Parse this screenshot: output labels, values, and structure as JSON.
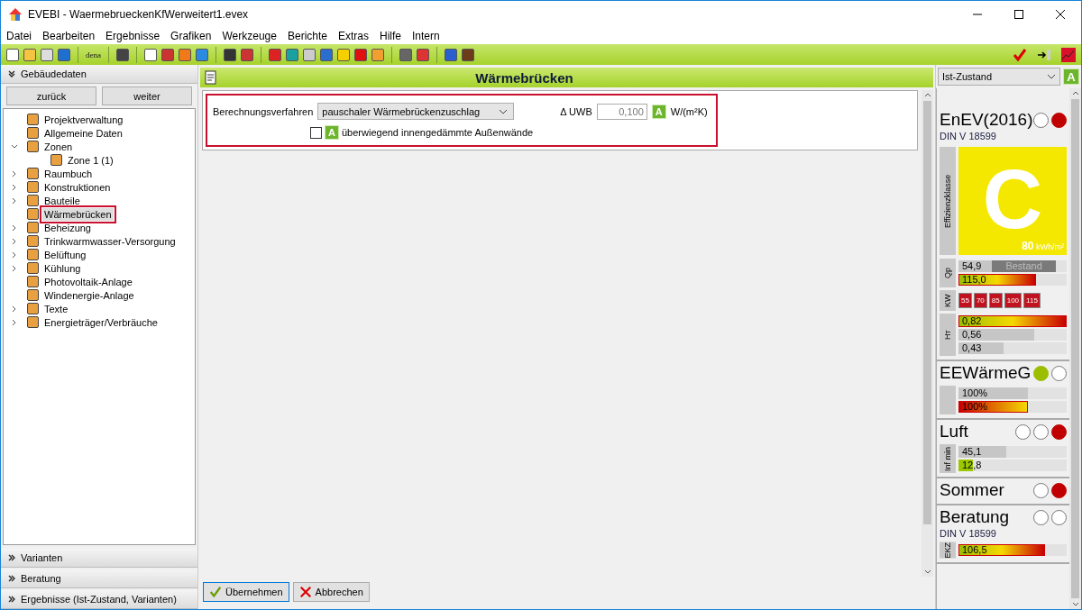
{
  "window": {
    "title": "EVEBI - WaermebrueckenKfWerweitert1.evex"
  },
  "menu": [
    "Datei",
    "Bearbeiten",
    "Ergebnisse",
    "Grafiken",
    "Werkzeuge",
    "Berichte",
    "Extras",
    "Hilfe",
    "Intern"
  ],
  "toolbar": {
    "text_button": "dena"
  },
  "sidebar": {
    "header": "Gebäudedaten",
    "nav_buttons": [
      "zurück",
      "weiter"
    ],
    "tree": [
      {
        "label": "Projektverwaltung",
        "selected": false
      },
      {
        "label": "Allgemeine Daten",
        "selected": false
      },
      {
        "label": "Zonen",
        "selected": false,
        "expanded": true,
        "children": [
          {
            "label": "Zone 1 (1)",
            "selected": false
          }
        ]
      },
      {
        "label": "Raumbuch",
        "selected": false,
        "expanded": false
      },
      {
        "label": "Konstruktionen",
        "selected": false,
        "expanded": false
      },
      {
        "label": "Bauteile",
        "selected": false,
        "expanded": false
      },
      {
        "label": "Wärmebrücken",
        "selected": true
      },
      {
        "label": "Beheizung",
        "selected": false,
        "expanded": false
      },
      {
        "label": "Trinkwarmwasser-Versorgung",
        "selected": false,
        "expanded": false
      },
      {
        "label": "Belüftung",
        "selected": false,
        "expanded": false
      },
      {
        "label": "Kühlung",
        "selected": false,
        "expanded": false
      },
      {
        "label": "Photovoltaik-Anlage",
        "selected": false
      },
      {
        "label": "Windenergie-Anlage",
        "selected": false
      },
      {
        "label": "Texte",
        "selected": false,
        "expanded": false
      },
      {
        "label": "Energieträger/Verbräuche",
        "selected": false,
        "expanded": false
      }
    ],
    "sections": [
      "Varianten",
      "Beratung",
      "Ergebnisse (Ist-Zustand, Varianten)"
    ]
  },
  "main": {
    "title": "Wärmebrücken",
    "form": {
      "method_label": "Berechnungsverfahren",
      "method_value": "pauschaler Wärmebrückenzuschlag",
      "uwb_label": "Δ UWB",
      "uwb_value": "0,100",
      "uwb_badge": "A",
      "uwb_unit": "W/(m²K)",
      "checkbox": {
        "checked": false,
        "badge": "A",
        "label": "überwiegend innengedämmte Außenwände"
      }
    },
    "buttons": [
      "Übernehmen",
      "Abbrechen"
    ]
  },
  "results": {
    "variant": "Ist-Zustand",
    "variant_badge": "A",
    "sections": [
      {
        "kind": "enev",
        "title": "EnEV(2016)",
        "lights": [
          {
            "on": false
          },
          {
            "on": true,
            "color": "#c00000"
          }
        ],
        "subtitle": "DIN V 18599",
        "class_label": "Effizienzklasse",
        "class": "C",
        "class_value": "80",
        "class_unit": "kWh/m²",
        "groups": [
          {
            "label": "Qp",
            "rows": [
              {
                "kind": "grey",
                "text": "54,9",
                "level": 0.31,
                "tag": "Bestand"
              },
              {
                "kind": "gradient",
                "text": "115,0",
                "level": 0.72
              }
            ]
          },
          {
            "label": "KW",
            "boxes": [
              "55",
              "70",
              "85",
              "100",
              "115"
            ]
          },
          {
            "label": "H$_{T}$",
            "rows": [
              {
                "kind": "gradient",
                "text": "0,82",
                "level": 1.0
              },
              {
                "kind": "grey",
                "text": "0,56",
                "level": 0.7
              },
              {
                "kind": "grey",
                "text": "0,43",
                "level": 0.42
              }
            ]
          }
        ]
      },
      {
        "kind": "plain",
        "title": "EEWärmeG",
        "lights": [
          {
            "on": true,
            "color": "#9cbe00"
          },
          {
            "on": false
          }
        ],
        "groups": [
          {
            "rows": [
              {
                "kind": "grey",
                "text": "100%",
                "level": 0.64
              },
              {
                "kind": "reverse",
                "text": "100%",
                "level": 0.64
              }
            ]
          }
        ]
      },
      {
        "kind": "plain",
        "title": "Luft",
        "lights": [
          {
            "on": false
          },
          {
            "on": false
          },
          {
            "on": true,
            "color": "#c00000"
          }
        ],
        "groups": [
          {
            "label": "Inf min",
            "rows": [
              {
                "kind": "grey",
                "text": "45,1",
                "level": 0.44
              },
              {
                "kind": "green",
                "text": "12,8",
                "level": 0.13
              }
            ]
          }
        ]
      },
      {
        "kind": "plain",
        "title": "Sommer",
        "lights": [
          {
            "on": false
          },
          {
            "on": true,
            "color": "#c00000"
          }
        ]
      },
      {
        "kind": "plain",
        "title": "Beratung",
        "lights": [
          {
            "on": false
          },
          {
            "on": false
          }
        ],
        "subtitle": "DIN V 18599",
        "groups": [
          {
            "label": "EKZ",
            "rows": [
              {
                "kind": "gradient",
                "text": "106,5",
                "level": 0.8
              }
            ]
          }
        ]
      }
    ]
  }
}
